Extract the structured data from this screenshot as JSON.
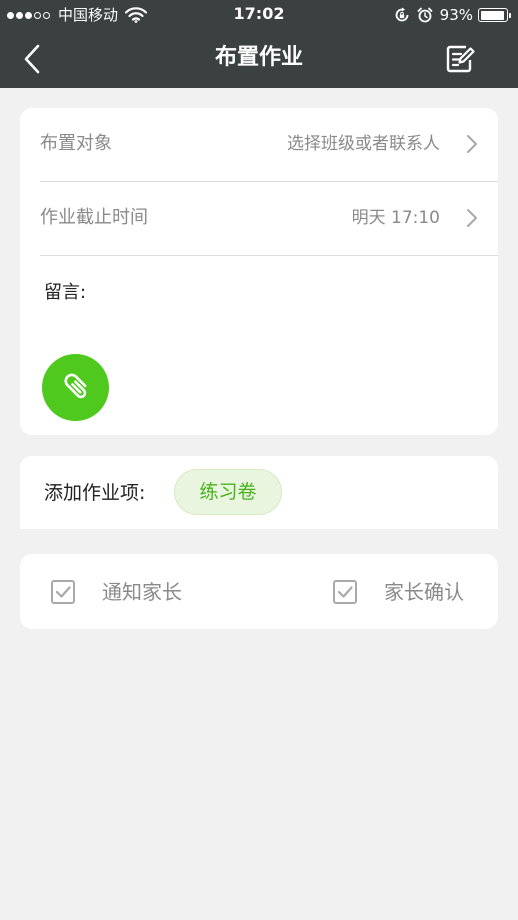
{
  "status_bar": {
    "carrier": "中国移动",
    "time": "17:02",
    "battery_label": "93%",
    "battery_level": 0.93,
    "signal_bars": 3,
    "signal_total": 5,
    "icons": [
      "wifi-icon",
      "rotation-lock-icon",
      "alarm-icon",
      "battery-icon"
    ]
  },
  "navbar": {
    "title": "布置作业",
    "back_icon": "chevron-left-icon",
    "action_icon": "edit-icon"
  },
  "form": {
    "target": {
      "label": "布置对象",
      "value": "选择班级或者联系人"
    },
    "deadline": {
      "label": "作业截止时间",
      "value": "明天 17:10"
    },
    "note_label": "留言:",
    "attach_icon": "paperclip-icon"
  },
  "items": {
    "label": "添加作业项:",
    "chips": [
      "练习卷"
    ]
  },
  "options": [
    {
      "label": "通知家长",
      "checked": true
    },
    {
      "label": "家长确认",
      "checked": true
    }
  ],
  "colors": {
    "header_bg": "#3b4141",
    "accent_green": "#4fc91d",
    "chip_text": "#48b21c",
    "chip_bg": "#e9f5df",
    "page_bg": "#f1f1f1"
  }
}
